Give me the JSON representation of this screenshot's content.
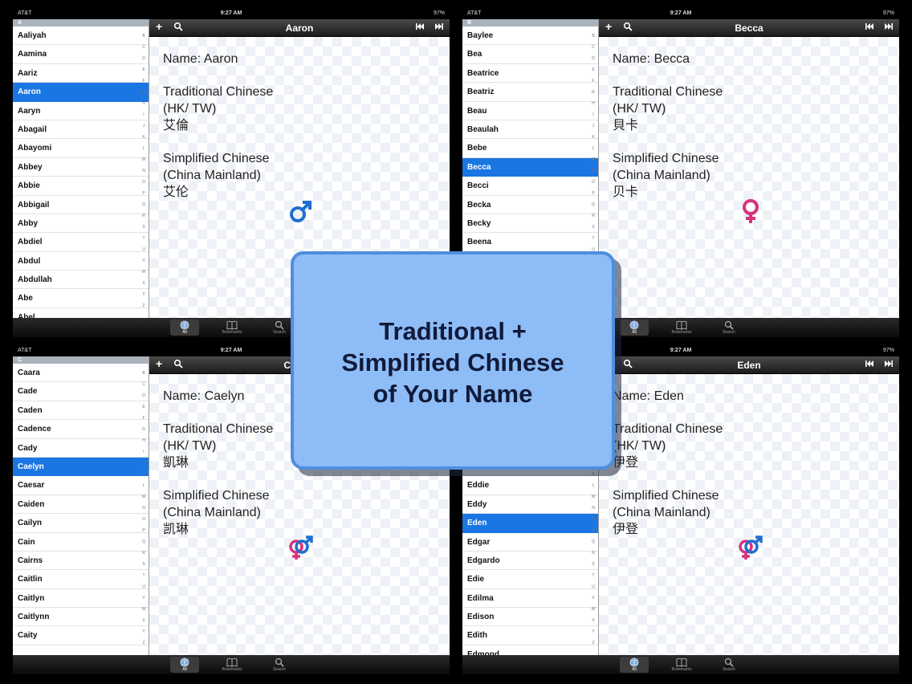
{
  "colors": {
    "selection": "#1a76e3",
    "overlay_fill": "#8dbcf6",
    "overlay_border": "#4f8ee0",
    "male": "#1f6fd0",
    "female": "#d6337c"
  },
  "overlay": {
    "line1": "Traditional +",
    "line2": "Simplified Chinese",
    "line3": "of Your Name"
  },
  "panels": [
    {
      "status": {
        "carrier": "AT&T",
        "time": "9:27 AM",
        "battery": "97%"
      },
      "section_letter": "A",
      "list_items": [
        "Aaliyah",
        "Aamina",
        "Aariz",
        "Aaron",
        "Aaryn",
        "Abagail",
        "Abayomi",
        "Abbey",
        "Abbie",
        "Abbigail",
        "Abby",
        "Abdiel",
        "Abdul",
        "Abdullah",
        "Abe",
        "Abel"
      ],
      "selected_index": 3,
      "index_letters": [
        "B",
        "C",
        "D",
        "E",
        "F",
        "G",
        "H",
        "I",
        "J",
        "K",
        "L",
        "M",
        "N",
        "O",
        "P",
        "Q",
        "R",
        "S",
        "T",
        "U",
        "V",
        "W",
        "X",
        "Y",
        "Z"
      ],
      "nav_title": "Aaron",
      "detail": {
        "name": "Name: Aaron",
        "trad_label_1": "Traditional Chinese",
        "trad_label_2": "(HK/ TW)",
        "trad_value": "艾倫",
        "simp_label_1": "Simplified Chinese",
        "simp_label_2": "(China Mainland)",
        "simp_value": "艾伦"
      },
      "gender_icon": "male-symbol-icon",
      "tabs": {
        "all": "All",
        "bookmarks": "Bookmarks",
        "search": "Search"
      }
    },
    {
      "status": {
        "carrier": "AT&T",
        "time": "9:27 AM",
        "battery": "97%"
      },
      "section_letter": "B",
      "list_items": [
        "Baylee",
        "Bea",
        "Beatrice",
        "Beatriz",
        "Beau",
        "Beaulah",
        "Bebe",
        "Becca",
        "Becci",
        "Becka",
        "Becky",
        "Beena"
      ],
      "selected_index": 7,
      "index_letters": [
        "B",
        "C",
        "D",
        "E",
        "F",
        "G",
        "H",
        "I",
        "J",
        "K",
        "L",
        "M",
        "N",
        "O",
        "P",
        "Q",
        "R",
        "S",
        "T",
        "U",
        "V",
        "W",
        "X",
        "Y",
        "Z"
      ],
      "nav_title": "Becca",
      "detail": {
        "name": "Name: Becca",
        "trad_label_1": "Traditional Chinese",
        "trad_label_2": "(HK/ TW)",
        "trad_value": "貝卡",
        "simp_label_1": "Simplified Chinese",
        "simp_label_2": "(China Mainland)",
        "simp_value": "贝卡"
      },
      "gender_icon": "female-symbol-icon",
      "tabs": {
        "all": "All",
        "bookmarks": "Bookmarks",
        "search": "Search"
      }
    },
    {
      "status": {
        "carrier": "AT&T",
        "time": "9:27 AM",
        "battery": "97%"
      },
      "section_letter": "C",
      "list_items": [
        "Caara",
        "Cade",
        "Caden",
        "Cadence",
        "Cady",
        "Caelyn",
        "Caesar",
        "Caiden",
        "Cailyn",
        "Cain",
        "Cairns",
        "Caitlin",
        "Caitlyn",
        "Caitlynn",
        "Caity"
      ],
      "selected_index": 5,
      "index_letters": [
        "B",
        "C",
        "D",
        "E",
        "F",
        "G",
        "H",
        "I",
        "J",
        "K",
        "L",
        "M",
        "N",
        "O",
        "P",
        "Q",
        "R",
        "S",
        "T",
        "U",
        "V",
        "W",
        "X",
        "Y",
        "Z"
      ],
      "nav_title": "Caelyn",
      "detail": {
        "name": "Name: Caelyn",
        "trad_label_1": "Traditional Chinese",
        "trad_label_2": "(HK/ TW)",
        "trad_value": "凱琳",
        "simp_label_1": "Simplified Chinese",
        "simp_label_2": "(China Mainland)",
        "simp_value": "凯琳"
      },
      "gender_icon": "unisex-symbol-icon",
      "tabs": {
        "all": "All",
        "bookmarks": "Bookmarks",
        "search": "Search"
      }
    },
    {
      "status": {
        "carrier": "AT&T",
        "time": "9:27 AM",
        "battery": "97%"
      },
      "section_letter": "E",
      "list_items": [
        "Easton",
        "Eban",
        "Ebba",
        "Ebony",
        "Echo",
        "Ed",
        "Eddie",
        "Eddy",
        "Eden",
        "Edgar",
        "Edgardo",
        "Edie",
        "Edilma",
        "Edison",
        "Edith",
        "Edmond",
        "Edna"
      ],
      "selected_index": 8,
      "index_letters": [
        "B",
        "C",
        "D",
        "E",
        "F",
        "G",
        "H",
        "I",
        "J",
        "K",
        "L",
        "M",
        "N",
        "O",
        "P",
        "Q",
        "R",
        "S",
        "T",
        "U",
        "V",
        "W",
        "X",
        "Y",
        "Z"
      ],
      "nav_title": "Eden",
      "detail": {
        "name": "Name: Eden",
        "trad_label_1": "Traditional Chinese",
        "trad_label_2": "(HK/ TW)",
        "trad_value": "伊登",
        "simp_label_1": "Simplified Chinese",
        "simp_label_2": "(China Mainland)",
        "simp_value": "伊登"
      },
      "gender_icon": "unisex-symbol-icon",
      "tabs": {
        "all": "All",
        "bookmarks": "Bookmarks",
        "search": "Search"
      }
    }
  ]
}
